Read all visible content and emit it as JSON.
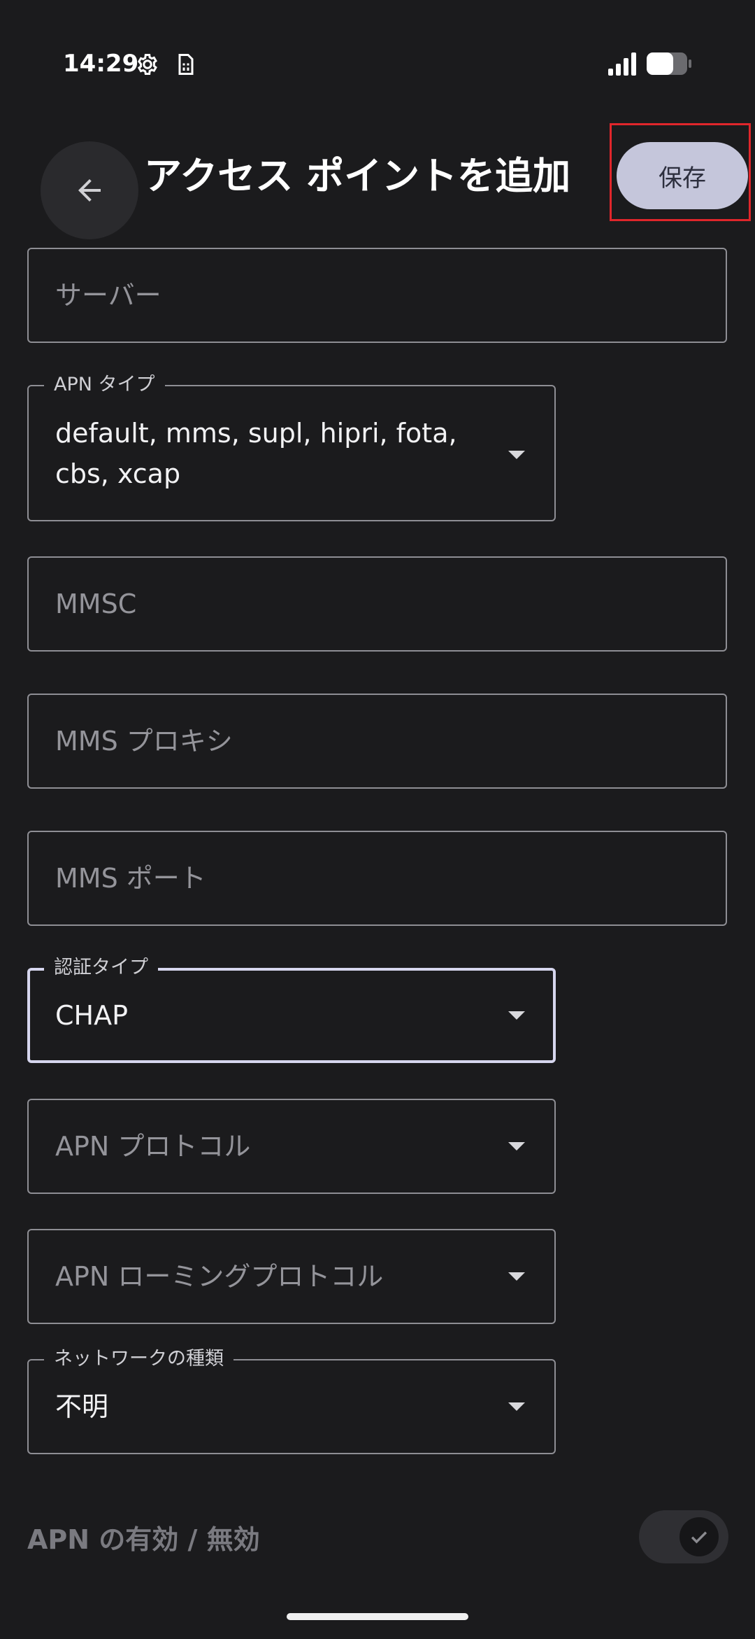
{
  "status_bar": {
    "time": "14:29",
    "icons": [
      "settings-gear-icon",
      "sim-card-icon",
      "signal-strength-icon",
      "battery-icon"
    ]
  },
  "app_bar": {
    "title": "アクセス ポイントを追加",
    "save_label": "保存",
    "back_icon": "arrow-left-icon"
  },
  "fields": {
    "server": {
      "placeholder": "サーバー"
    },
    "apn_type": {
      "label": "APN タイプ",
      "value_line1": "default, mms, supl, hipri, fota,",
      "value_line2": "cbs, xcap"
    },
    "mmsc": {
      "placeholder": "MMSC"
    },
    "mms_proxy": {
      "placeholder": "MMS プロキシ"
    },
    "mms_port": {
      "placeholder": "MMS ポート"
    },
    "auth_type": {
      "label": "認証タイプ",
      "value": "CHAP"
    },
    "apn_protocol": {
      "placeholder": "APN プロトコル"
    },
    "apn_roaming_protocol": {
      "placeholder": "APN ローミングプロトコル"
    },
    "network_type": {
      "label": "ネットワークの種類",
      "value": "不明"
    }
  },
  "apn_toggle": {
    "label": "APN の有効 / 無効",
    "enabled": true
  },
  "colors": {
    "background": "#1b1b1d",
    "save_button": "#c5c6db",
    "highlight": "#e0262b"
  }
}
